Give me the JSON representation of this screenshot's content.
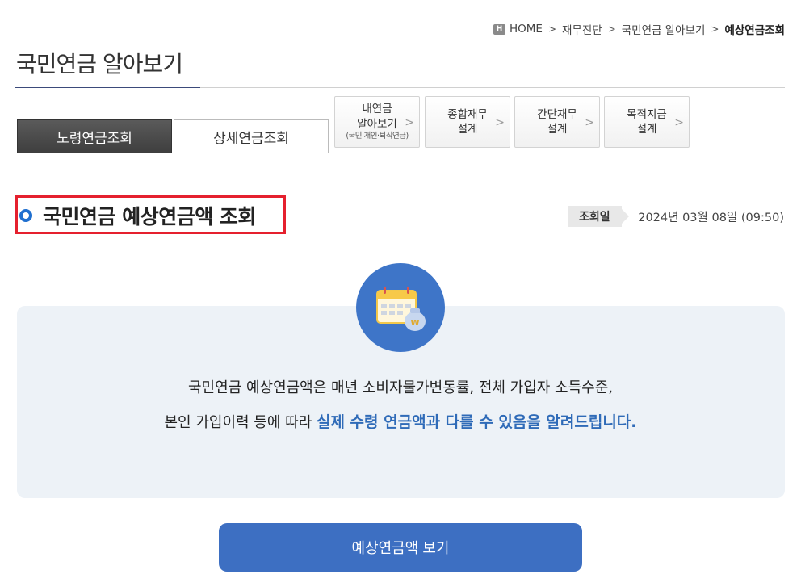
{
  "breadcrumb": {
    "home_icon": "home-icon",
    "home": "HOME",
    "items": [
      "재무진단",
      "국민연금 알아보기"
    ],
    "current": "예상연금조회",
    "separator": ">"
  },
  "page_title": "국민연금 알아보기",
  "tabs": {
    "active": "노령연금조회",
    "inactive": "상세연금조회"
  },
  "side_buttons": [
    {
      "line1": "내연금",
      "line2": "알아보기",
      "sub": "(국민·개인·퇴직연금)"
    },
    {
      "line1": "종합재무",
      "line2": "설계"
    },
    {
      "line1": "간단재무",
      "line2": "설계"
    },
    {
      "line1": "목적지금",
      "line2": "설계"
    }
  ],
  "chevron": ">",
  "section": {
    "title": "국민연금 예상연금액 조회",
    "date_label": "조회일",
    "date_value": "2024년 03월 08일 (09:50)"
  },
  "info": {
    "line1": "국민연금 예상연금액은 매년 소비자물가변동률, 전체 가입자 소득수준,",
    "line2_plain": "본인 가입이력 등에 따라 ",
    "line2_highlight": "실제 수령 연금액과 다를 수 있음을 알려드립니다.",
    "icon": "calendar-moneybag-icon"
  },
  "view_button": "예상연금액 보기",
  "colors": {
    "accent_blue": "#3d6fc2",
    "highlight_text": "#2f6bb8",
    "panel_bg": "#edf2f7",
    "focus_border": "#e5202e",
    "icon_circle": "#3e75c8"
  }
}
